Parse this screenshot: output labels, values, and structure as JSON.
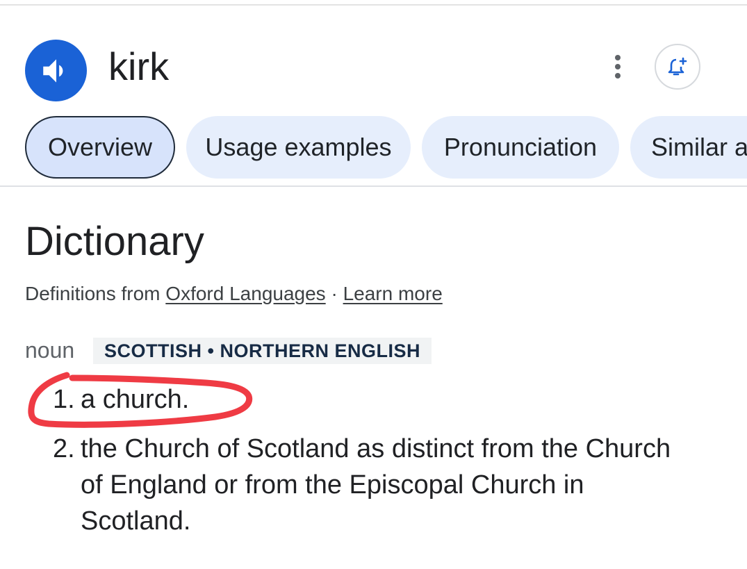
{
  "header": {
    "word": "kirk",
    "speaker_icon": "volume-up-icon",
    "more_icon": "more-vert-icon",
    "alert_icon": "add-alert-icon",
    "accent_color": "#1a62d6"
  },
  "tabs": [
    {
      "label": "Overview",
      "active": true
    },
    {
      "label": "Usage examples",
      "active": false
    },
    {
      "label": "Pronunciation",
      "active": false
    },
    {
      "label": "Similar a",
      "active": false
    }
  ],
  "dictionary": {
    "heading": "Dictionary",
    "source_prefix": "Definitions from",
    "source_link": "Oxford Languages",
    "separator": "·",
    "learn_more": "Learn more",
    "part_of_speech": "noun",
    "usage_label": "SCOTTISH • NORTHERN ENGLISH",
    "definitions": [
      {
        "num": "1.",
        "lines": [
          "a church."
        ]
      },
      {
        "num": "2.",
        "lines": [
          "the Church of Scotland as distinct from the Church",
          "of England or from the Episcopal Church in",
          "Scotland."
        ]
      }
    ]
  },
  "annotation": {
    "color": "#ef3b44",
    "target": "definition 1"
  }
}
